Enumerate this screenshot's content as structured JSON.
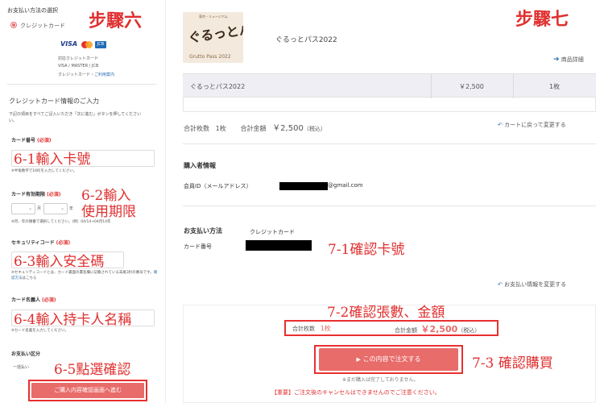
{
  "left": {
    "title": "お支払い方法の選択",
    "radio_label": "クレジットカード",
    "brands": [
      "VISA",
      "JCB"
    ],
    "supported_title": "対応クレジットカード",
    "supported_list": "VISA / MASTER / JCB",
    "credit_note": "クレジットカード・",
    "credit_note_link": "ご利用案内",
    "input_heading": "クレジットカード情報のご入力",
    "input_desc_1": "下記の項目をすべてご記入いただき「次に進む」ボタンを押してください",
    "input_desc_2": "い。",
    "card_number_label": "カード番号",
    "card_number_note": "※半角数字で16桁を入力してください。",
    "expiry_label": "カード有効期限",
    "expiry_month_unit": "月",
    "expiry_year_unit": "年",
    "expiry_note": "※月、年の順番で選択してください。(例）04/14→04月14年",
    "security_label": "セキュリティコード",
    "security_note_1": "※セキュリティコードとは、カード裏面の署名欄に記載されている末尾3桁の番号です。",
    "security_note_link": "確認方法",
    "security_note_2": "はこちら",
    "holder_label": "カード名義人",
    "holder_note": "※カード名義を入力してください。",
    "pay_type_label": "お支払い区分",
    "pay_type_value": "一括払い",
    "required_tag": "(必須)",
    "submit_label": "ご購入内容確認画面へ進む"
  },
  "right": {
    "product_logo_text": "ぐるっとパス",
    "product_logo_sub": "Grutto Pass 2022",
    "product_logo_top": "東京・ミュージアム",
    "product_name": "ぐるっとパス2022",
    "details_link": "商品詳細",
    "table_row": {
      "name": "ぐるっとパス2022",
      "price": "￥2,500",
      "qty": "1枚"
    },
    "total_count_label": "合計枚数",
    "total_count": "1枚",
    "total_amount_label": "合計金額",
    "total_amount": "￥2,500",
    "tax_note": "（税込）",
    "back_to_cart": "カートに戻って変更する",
    "buyer_heading": "購入者情報",
    "member_id_label": "会員ID（メールアドレス）",
    "email_domain": "@gmail.com",
    "payment_heading": "お支払い方法",
    "payment_value": "クレジットカード",
    "card_number_label": "カード番号",
    "change_payment": "お支払い情報を変更する",
    "summary_count_label": "合計枚数",
    "summary_count": "1枚",
    "summary_amount_label": "合計金額",
    "summary_amount": "￥2,500",
    "summary_tax": "（税込）",
    "order_button": "この内容で注文する",
    "order_note": "※まだ購入は完了しておりません。",
    "cancel_warning": "【重要】ご注文後のキャンセルはできませんのでご注意ください。"
  },
  "annotations": {
    "step6": "步驟六",
    "step7": "步驟七",
    "a61": "6-1輸入卡號",
    "a62a": "6-2輸入",
    "a62b": "使用期限",
    "a63": "6-3輸入安全碼",
    "a64": "6-4輸入持卡人名稱",
    "a65": "6-5點選確認",
    "a71": "7-1確認卡號",
    "a72": "7-2確認張數、金額",
    "a73": "7-3 確認購買"
  },
  "colors": {
    "annotation": "#e03030",
    "accent": "#e86c6a",
    "link": "#2a6fb0"
  }
}
